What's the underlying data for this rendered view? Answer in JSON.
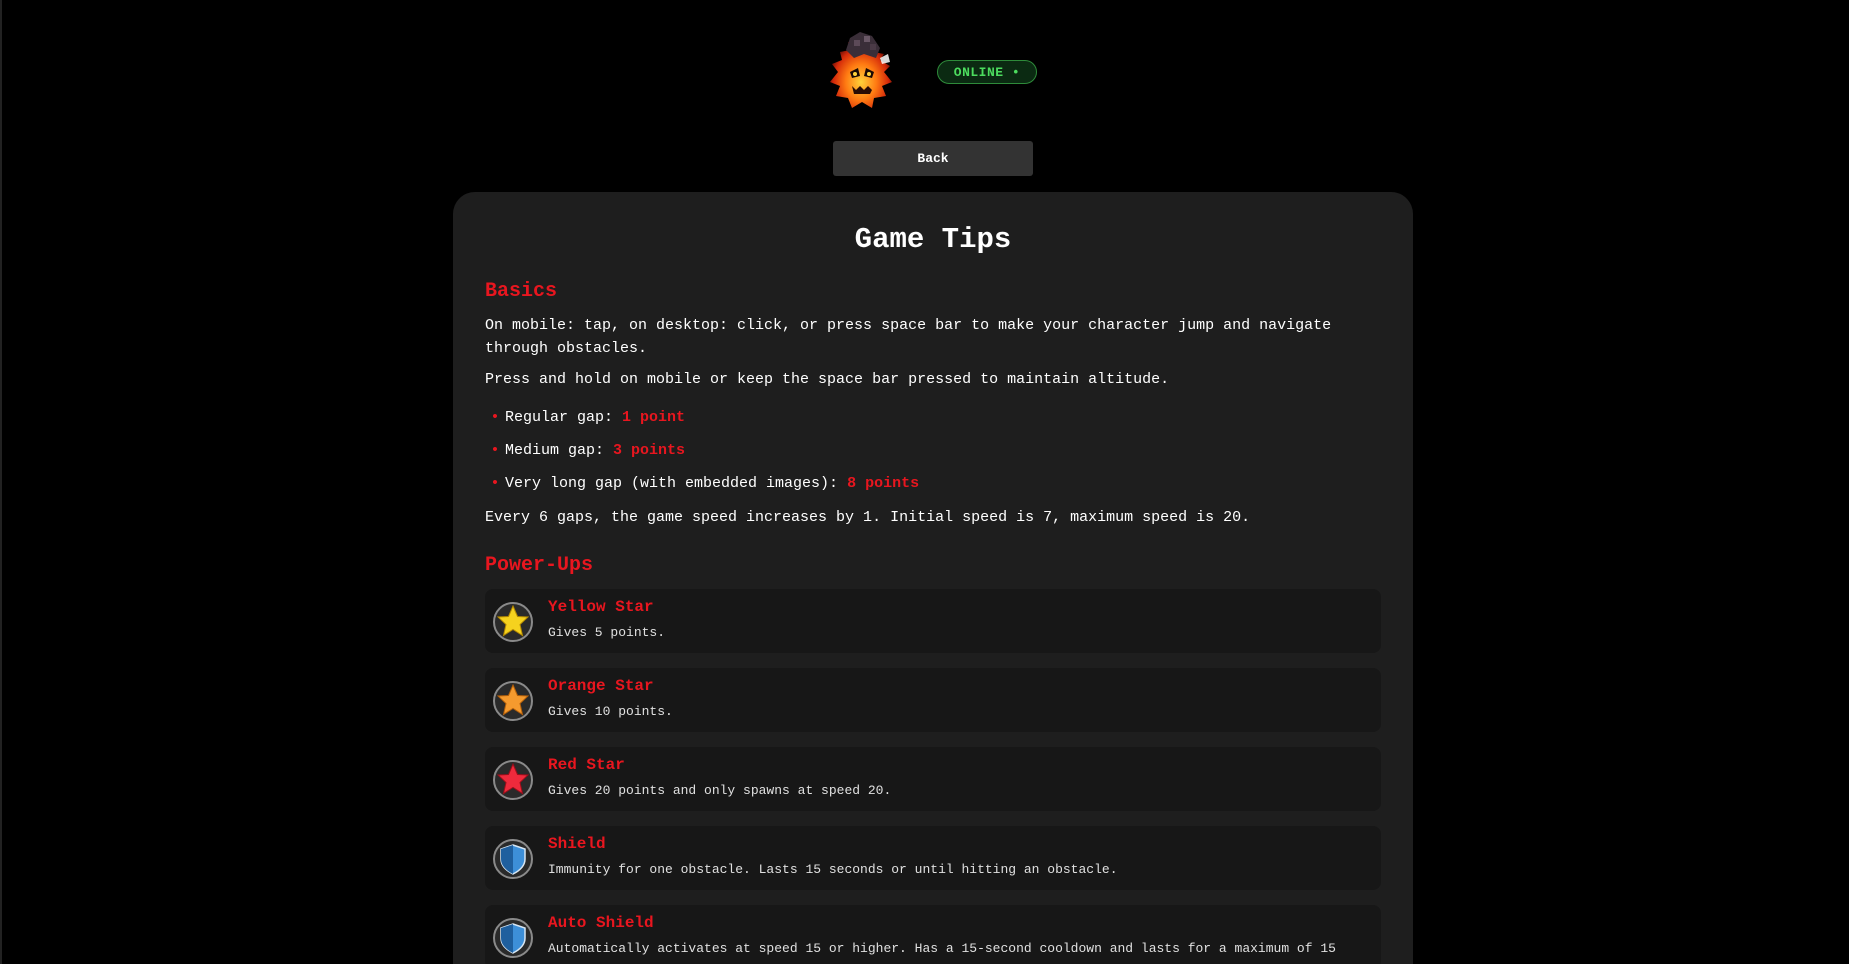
{
  "header": {
    "logo_icon": "flaming-skull-logo-icon",
    "status": "ONLINE •",
    "status_color": "#4cdc5e"
  },
  "nav": {
    "back_label": "Back"
  },
  "tips": {
    "title": "Game Tips",
    "basics": {
      "title": "Basics",
      "paragraph1": "On mobile: tap, on desktop: click, or press space bar to make your character jump and navigate through obstacles.",
      "paragraph2": "Press and hold on mobile or keep the space bar pressed to maintain altitude.",
      "gaps": [
        {
          "label": "Regular gap: ",
          "points": "1 point"
        },
        {
          "label": "Medium gap: ",
          "points": "3 points"
        },
        {
          "label": "Very long gap (with embedded images): ",
          "points": "8 points"
        }
      ],
      "speed_note": "Every 6 gaps, the game speed increases by 1. Initial speed is 7, maximum speed is 20."
    },
    "powerups": {
      "title": "Power-Ups",
      "items": [
        {
          "name": "Yellow Star",
          "desc": "Gives 5 points.",
          "icon": "yellow-star-icon",
          "color": "#f5d21e"
        },
        {
          "name": "Orange Star",
          "desc": "Gives 10 points.",
          "icon": "orange-star-icon",
          "color": "#f59a2e"
        },
        {
          "name": "Red Star",
          "desc": "Gives 20 points and only spawns at speed 20.",
          "icon": "red-star-icon",
          "color": "#ee2a3c"
        },
        {
          "name": "Shield",
          "desc": "Immunity for one obstacle. Lasts 15 seconds or until hitting an obstacle.",
          "icon": "shield-icon",
          "color": "#3d8fd8"
        },
        {
          "name": "Auto Shield",
          "desc": "Automatically activates at speed 15 or higher. Has a 15-second cooldown and lasts for a maximum of 15",
          "icon": "auto-shield-icon",
          "color": "#3d8fd8"
        }
      ]
    }
  },
  "colors": {
    "accent": "#e8161f",
    "background": "#000000",
    "card": "#1e1e1e",
    "row": "#171717"
  }
}
